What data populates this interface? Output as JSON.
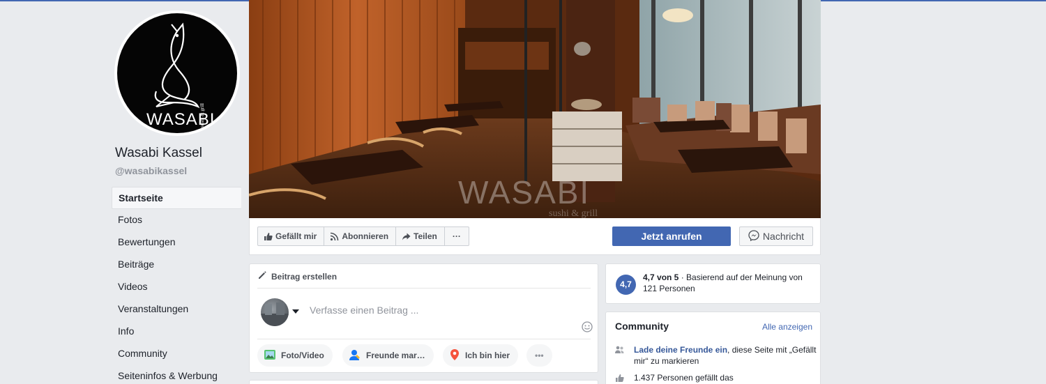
{
  "page": {
    "name": "Wasabi Kassel",
    "handle": "@wasabikassel",
    "logo": {
      "brand": "WASABI",
      "tagline": "sushi & grill"
    }
  },
  "nav": {
    "items": [
      {
        "label": "Startseite",
        "active": true
      },
      {
        "label": "Fotos"
      },
      {
        "label": "Bewertungen"
      },
      {
        "label": "Beiträge"
      },
      {
        "label": "Videos"
      },
      {
        "label": "Veranstaltungen"
      },
      {
        "label": "Info"
      },
      {
        "label": "Community"
      },
      {
        "label": "Seiteninfos & Werbung"
      }
    ]
  },
  "cover": {
    "watermark": "WASABI",
    "watermark_sub": "sushi & grill"
  },
  "actions": {
    "like": "Gefällt mir",
    "subscribe": "Abonnieren",
    "share": "Teilen",
    "more": "···",
    "call": "Jetzt anrufen",
    "message": "Nachricht"
  },
  "composer": {
    "title": "Beitrag erstellen",
    "placeholder": "Verfasse einen Beitrag ...",
    "photo_video": "Foto/Video",
    "tag_friends": "Freunde mar…",
    "check_in": "Ich bin hier",
    "more": "•••"
  },
  "rating": {
    "badge": "4,7",
    "score": "4,7 von 5",
    "separator": " · ",
    "text": "Basierend auf der Meinung von 121 Personen"
  },
  "community": {
    "title": "Community",
    "see_all": "Alle anzeigen",
    "invite_link": "Lade deine Freunde ein",
    "invite_rest": ", diese Seite mit „Gefällt mir“ zu markieren",
    "likes": "1.437 Personen gefällt das"
  },
  "colors": {
    "brand_blue": "#4267b2",
    "link_blue": "#365899",
    "background": "#e9ebee"
  }
}
